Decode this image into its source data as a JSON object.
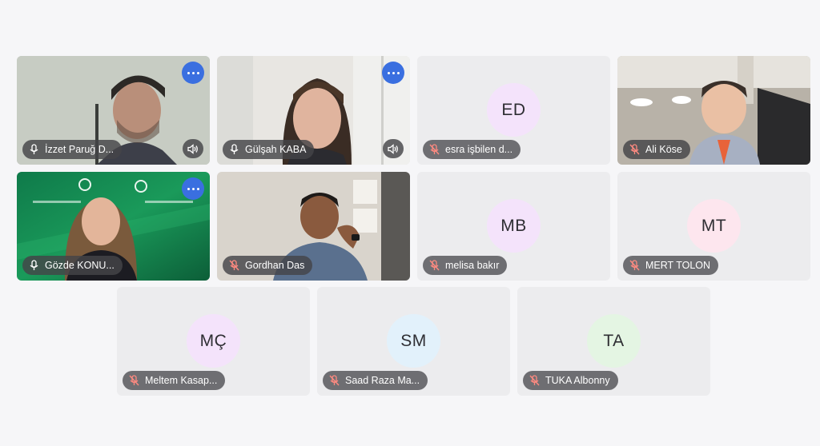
{
  "colors": {
    "tile_bg": "#ececee",
    "page_bg": "#f6f6f8",
    "pill_bg": "#444448",
    "more_button": "#3a6fe0",
    "muted_icon": "#ff8a80"
  },
  "participants": [
    {
      "name": "İzzet Paruğ D...",
      "initials": "",
      "video": true,
      "muted": false,
      "has_more": true,
      "has_volume": true
    },
    {
      "name": "Gülşah KABA",
      "initials": "",
      "video": true,
      "muted": false,
      "has_more": true,
      "has_volume": true
    },
    {
      "name": "esra işbilen d...",
      "initials": "ED",
      "video": false,
      "muted": true,
      "avatar_color": "#f4e3fb"
    },
    {
      "name": "Ali Köse",
      "initials": "",
      "video": true,
      "muted": true
    },
    {
      "name": "Gözde KONU...",
      "initials": "",
      "video": true,
      "muted": false,
      "has_more": true
    },
    {
      "name": "Gordhan Das",
      "initials": "",
      "video": true,
      "muted": true
    },
    {
      "name": "melisa bakır",
      "initials": "MB",
      "video": false,
      "muted": true,
      "avatar_color": "#f4e3fb"
    },
    {
      "name": "MERT TOLON",
      "initials": "MT",
      "video": false,
      "muted": true,
      "avatar_color": "#fde6ee"
    },
    {
      "name": "Meltem Kasap...",
      "initials": "MÇ",
      "video": false,
      "muted": true,
      "avatar_color": "#f4e3fb"
    },
    {
      "name": "Saad Raza Ma...",
      "initials": "SM",
      "video": false,
      "muted": true,
      "avatar_color": "#e2f1fb"
    },
    {
      "name": "TUKA Albonny",
      "initials": "TA",
      "video": false,
      "muted": true,
      "avatar_color": "#e4f5e3"
    }
  ]
}
